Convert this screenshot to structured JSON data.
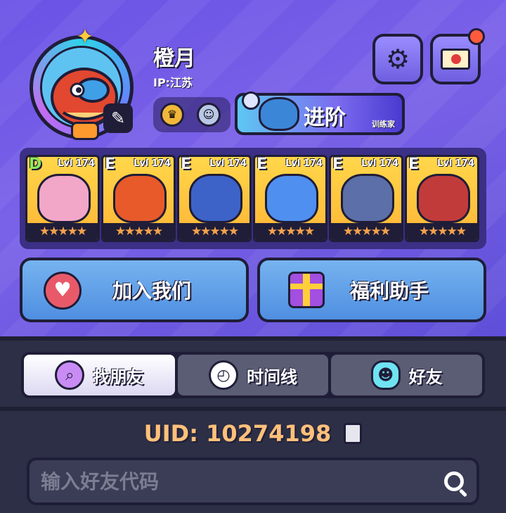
{
  "profile": {
    "name": "橙月",
    "ip": "IP:江苏"
  },
  "advance_banner": {
    "title": "进阶",
    "subtitle": "训练家"
  },
  "pets": [
    {
      "grade": "D",
      "level": "Lvl 174",
      "stars": "★★★★★",
      "color": "#f2a7c8"
    },
    {
      "grade": "E",
      "level": "Lvl 174",
      "stars": "★★★★★",
      "color": "#e85a2a"
    },
    {
      "grade": "E",
      "level": "Lvl 174",
      "stars": "★★★★★",
      "color": "#3d63c9"
    },
    {
      "grade": "E",
      "level": "Lvl 174",
      "stars": "★★★★★",
      "color": "#4f8ff0"
    },
    {
      "grade": "E",
      "level": "Lvl 174",
      "stars": "★★★★★",
      "color": "#5c6fa8"
    },
    {
      "grade": "E",
      "level": "Lvl 174",
      "stars": "★★★★★",
      "color": "#c23b3b"
    }
  ],
  "buttons": {
    "join_label": "加入我们",
    "welfare_label": "福利助手"
  },
  "tabs": [
    {
      "label": "找朋友",
      "icon": "magnifier-icon",
      "active": true
    },
    {
      "label": "时间线",
      "icon": "clock-icon",
      "active": false
    },
    {
      "label": "好友",
      "icon": "friends-icon",
      "active": false
    }
  ],
  "uid": {
    "text": "UID: 10274198"
  },
  "search": {
    "placeholder": "输入好友代码",
    "value": ""
  },
  "colors": {
    "accent": "#6a52e6",
    "uid": "#ffc07a",
    "button_blue": "#5f9fe8"
  }
}
